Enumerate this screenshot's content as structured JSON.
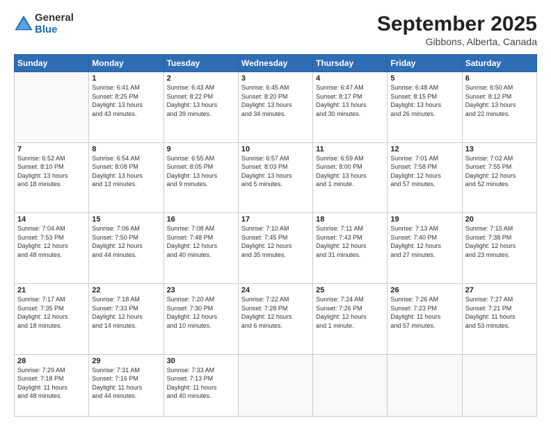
{
  "header": {
    "logo_general": "General",
    "logo_blue": "Blue",
    "month_title": "September 2025",
    "location": "Gibbons, Alberta, Canada"
  },
  "weekdays": [
    "Sunday",
    "Monday",
    "Tuesday",
    "Wednesday",
    "Thursday",
    "Friday",
    "Saturday"
  ],
  "weeks": [
    [
      {
        "day": "",
        "content": ""
      },
      {
        "day": "1",
        "content": "Sunrise: 6:41 AM\nSunset: 8:25 PM\nDaylight: 13 hours\nand 43 minutes."
      },
      {
        "day": "2",
        "content": "Sunrise: 6:43 AM\nSunset: 8:22 PM\nDaylight: 13 hours\nand 39 minutes."
      },
      {
        "day": "3",
        "content": "Sunrise: 6:45 AM\nSunset: 8:20 PM\nDaylight: 13 hours\nand 34 minutes."
      },
      {
        "day": "4",
        "content": "Sunrise: 6:47 AM\nSunset: 8:17 PM\nDaylight: 13 hours\nand 30 minutes."
      },
      {
        "day": "5",
        "content": "Sunrise: 6:48 AM\nSunset: 8:15 PM\nDaylight: 13 hours\nand 26 minutes."
      },
      {
        "day": "6",
        "content": "Sunrise: 6:50 AM\nSunset: 8:12 PM\nDaylight: 13 hours\nand 22 minutes."
      }
    ],
    [
      {
        "day": "7",
        "content": "Sunrise: 6:52 AM\nSunset: 8:10 PM\nDaylight: 13 hours\nand 18 minutes."
      },
      {
        "day": "8",
        "content": "Sunrise: 6:54 AM\nSunset: 8:08 PM\nDaylight: 13 hours\nand 13 minutes."
      },
      {
        "day": "9",
        "content": "Sunrise: 6:55 AM\nSunset: 8:05 PM\nDaylight: 13 hours\nand 9 minutes."
      },
      {
        "day": "10",
        "content": "Sunrise: 6:57 AM\nSunset: 8:03 PM\nDaylight: 13 hours\nand 5 minutes."
      },
      {
        "day": "11",
        "content": "Sunrise: 6:59 AM\nSunset: 8:00 PM\nDaylight: 13 hours\nand 1 minute."
      },
      {
        "day": "12",
        "content": "Sunrise: 7:01 AM\nSunset: 7:58 PM\nDaylight: 12 hours\nand 57 minutes."
      },
      {
        "day": "13",
        "content": "Sunrise: 7:02 AM\nSunset: 7:55 PM\nDaylight: 12 hours\nand 52 minutes."
      }
    ],
    [
      {
        "day": "14",
        "content": "Sunrise: 7:04 AM\nSunset: 7:53 PM\nDaylight: 12 hours\nand 48 minutes."
      },
      {
        "day": "15",
        "content": "Sunrise: 7:06 AM\nSunset: 7:50 PM\nDaylight: 12 hours\nand 44 minutes."
      },
      {
        "day": "16",
        "content": "Sunrise: 7:08 AM\nSunset: 7:48 PM\nDaylight: 12 hours\nand 40 minutes."
      },
      {
        "day": "17",
        "content": "Sunrise: 7:10 AM\nSunset: 7:45 PM\nDaylight: 12 hours\nand 35 minutes."
      },
      {
        "day": "18",
        "content": "Sunrise: 7:11 AM\nSunset: 7:43 PM\nDaylight: 12 hours\nand 31 minutes."
      },
      {
        "day": "19",
        "content": "Sunrise: 7:13 AM\nSunset: 7:40 PM\nDaylight: 12 hours\nand 27 minutes."
      },
      {
        "day": "20",
        "content": "Sunrise: 7:15 AM\nSunset: 7:38 PM\nDaylight: 12 hours\nand 23 minutes."
      }
    ],
    [
      {
        "day": "21",
        "content": "Sunrise: 7:17 AM\nSunset: 7:35 PM\nDaylight: 12 hours\nand 18 minutes."
      },
      {
        "day": "22",
        "content": "Sunrise: 7:18 AM\nSunset: 7:33 PM\nDaylight: 12 hours\nand 14 minutes."
      },
      {
        "day": "23",
        "content": "Sunrise: 7:20 AM\nSunset: 7:30 PM\nDaylight: 12 hours\nand 10 minutes."
      },
      {
        "day": "24",
        "content": "Sunrise: 7:22 AM\nSunset: 7:28 PM\nDaylight: 12 hours\nand 6 minutes."
      },
      {
        "day": "25",
        "content": "Sunrise: 7:24 AM\nSunset: 7:26 PM\nDaylight: 12 hours\nand 1 minute."
      },
      {
        "day": "26",
        "content": "Sunrise: 7:26 AM\nSunset: 7:23 PM\nDaylight: 11 hours\nand 57 minutes."
      },
      {
        "day": "27",
        "content": "Sunrise: 7:27 AM\nSunset: 7:21 PM\nDaylight: 11 hours\nand 53 minutes."
      }
    ],
    [
      {
        "day": "28",
        "content": "Sunrise: 7:29 AM\nSunset: 7:18 PM\nDaylight: 11 hours\nand 48 minutes."
      },
      {
        "day": "29",
        "content": "Sunrise: 7:31 AM\nSunset: 7:16 PM\nDaylight: 11 hours\nand 44 minutes."
      },
      {
        "day": "30",
        "content": "Sunrise: 7:33 AM\nSunset: 7:13 PM\nDaylight: 11 hours\nand 40 minutes."
      },
      {
        "day": "",
        "content": ""
      },
      {
        "day": "",
        "content": ""
      },
      {
        "day": "",
        "content": ""
      },
      {
        "day": "",
        "content": ""
      }
    ]
  ]
}
